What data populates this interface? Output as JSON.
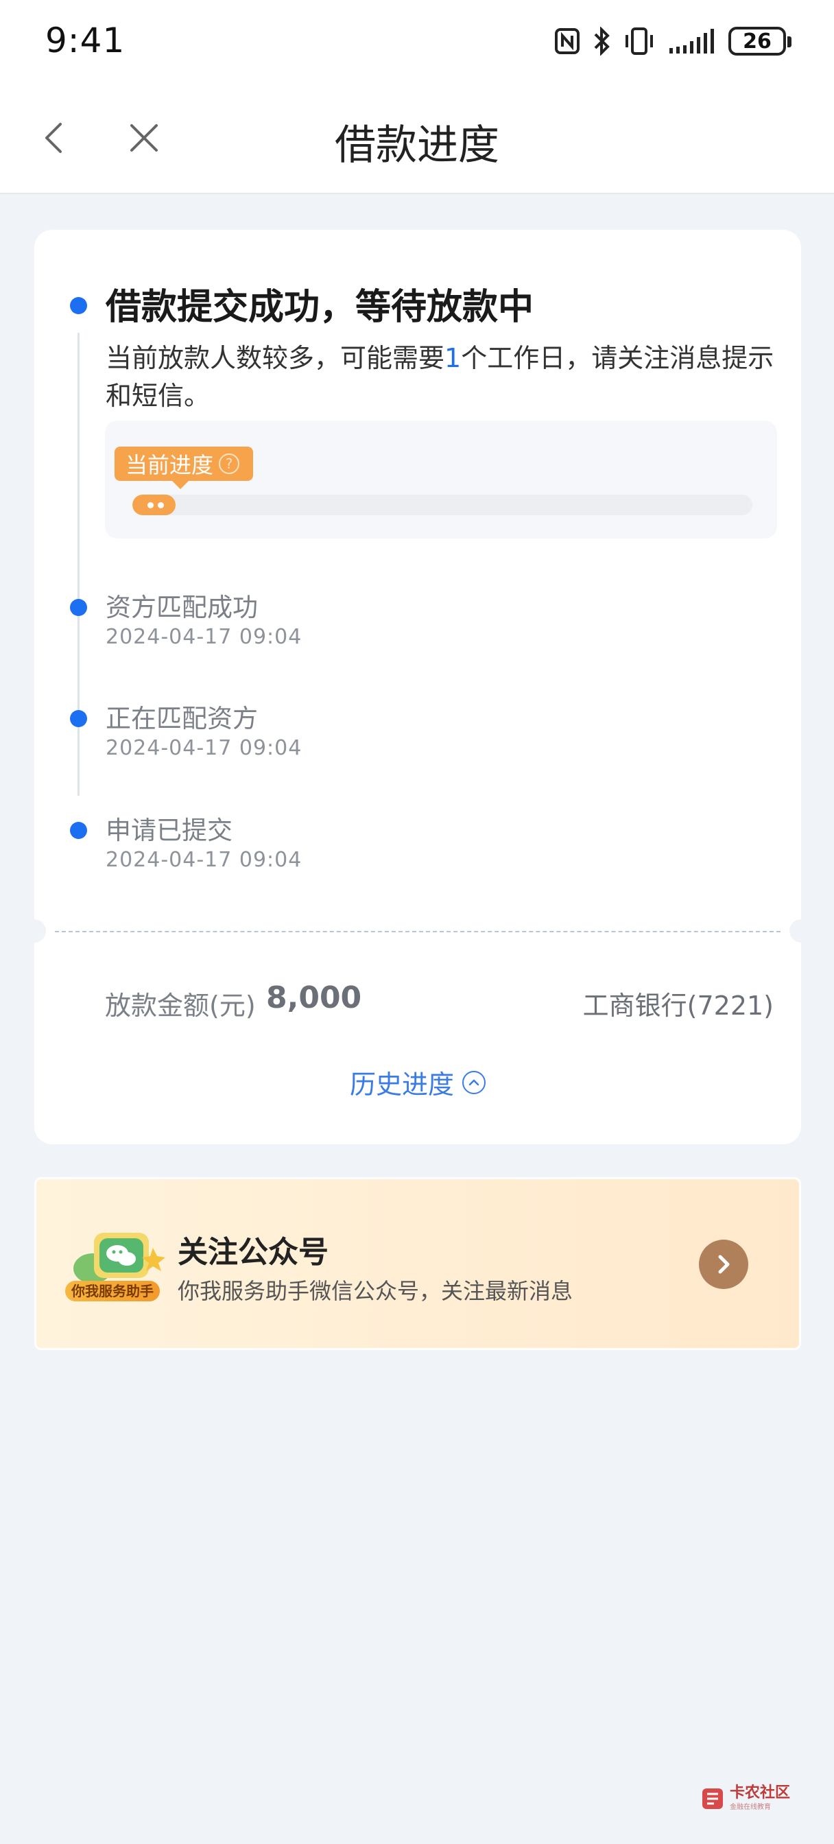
{
  "status_bar": {
    "time": "9:41",
    "battery": "26",
    "icons": [
      "nfc-icon",
      "bluetooth-icon",
      "vibrate-icon",
      "signal-icon",
      "battery-icon"
    ]
  },
  "nav": {
    "title": "借款进度",
    "back_icon": "chevron-left-icon",
    "close_icon": "close-icon"
  },
  "progress": {
    "current_step": {
      "title": "借款提交成功，等待放款中",
      "desc_before": "当前放款人数较多，可能需要",
      "desc_highlight": "1",
      "desc_after": "个工作日，请关注消息提示和短信。"
    },
    "progress_tag": "当前进度",
    "progress_fraction": 0.07,
    "steps": [
      {
        "title": "资方匹配成功",
        "time": "2024-04-17 09:04"
      },
      {
        "title": "正在匹配资方",
        "time": "2024-04-17 09:04"
      },
      {
        "title": "申请已提交",
        "time": "2024-04-17 09:04"
      }
    ]
  },
  "loan": {
    "amount_label": "放款金额(元)",
    "amount_value": "8,000",
    "bank": "工商银行(7221)",
    "history_link": "历史进度"
  },
  "follow": {
    "title": "关注公众号",
    "desc": "你我服务助手微信公众号，关注最新消息",
    "logo_badge": "你我服务助手"
  },
  "watermark": {
    "text": "卡农社区",
    "sub": "金融在线教育"
  },
  "colors": {
    "accent_blue": "#1d6ff2",
    "progress_orange": "#f7a34c",
    "page_bg": "#f0f3f8"
  }
}
